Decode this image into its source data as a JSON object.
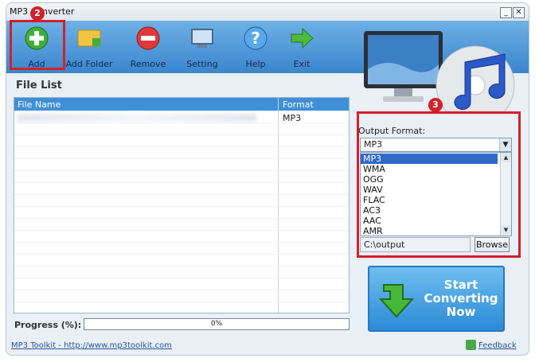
{
  "window": {
    "title": "MP3 Converter",
    "minimize": "_",
    "close": "✕"
  },
  "toolbar": {
    "add": "Add",
    "add_folder": "Add Folder",
    "remove": "Remove",
    "setting": "Setting",
    "help": "Help",
    "exit": "Exit"
  },
  "markers": {
    "add": "2",
    "output": "3"
  },
  "file_list": {
    "title": "File List",
    "col_name": "File Name",
    "col_format": "Format",
    "rows": [
      {
        "format": "MP3"
      }
    ]
  },
  "output": {
    "label": "Output Format:",
    "selected": "MP3",
    "options": [
      "MP3",
      "WMA",
      "OGG",
      "WAV",
      "FLAC",
      "AC3",
      "AAC",
      "AMR"
    ],
    "path": "C:\\output",
    "browse": "Browse"
  },
  "convert": {
    "line1": "Start",
    "line2": "Converting",
    "line3": "Now"
  },
  "progress": {
    "label": "Progress (%):",
    "value_text": "0%",
    "value": 0
  },
  "footer": {
    "link": "MP3 Toolkit - http://www.mp3toolkit.com",
    "feedback": "Feedback"
  },
  "colors": {
    "highlight": "#d4202a",
    "toolbar": "#3a85cc",
    "selection": "#3169c6"
  }
}
